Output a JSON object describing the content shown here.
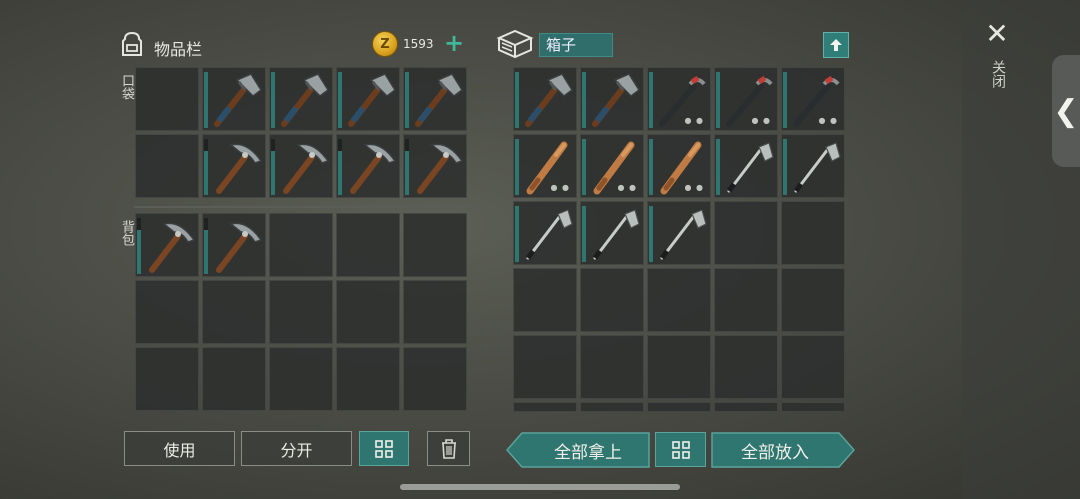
{
  "inventory": {
    "title": "物品栏",
    "coins": "1593",
    "coin_glyph": "Z",
    "plus_label": "+",
    "pocket_label": "口袋",
    "backpack_label": "背包",
    "pocket_rows": [
      [
        "",
        "axe",
        "axe",
        "axe",
        "axe"
      ],
      [
        "",
        "pickaxe",
        "pickaxe",
        "pickaxe",
        "pickaxe"
      ]
    ],
    "backpack_rows": [
      [
        "pickaxe",
        "pickaxe",
        "",
        "",
        ""
      ],
      [
        "",
        "",
        "",
        "",
        ""
      ],
      [
        "",
        "",
        "",
        "",
        ""
      ]
    ]
  },
  "box": {
    "title": "箱子",
    "rows": [
      [
        "axe",
        "axe",
        "crowbar",
        "crowbar",
        "crowbar"
      ],
      [
        "bat",
        "bat",
        "bat",
        "golf-club",
        "golf-club"
      ],
      [
        "golf-club",
        "golf-club",
        "golf-club",
        "",
        ""
      ],
      [
        "",
        "",
        "",
        "",
        ""
      ],
      [
        "",
        "",
        "",
        "",
        ""
      ]
    ]
  },
  "buttons": {
    "use": "使用",
    "split": "分开",
    "take_all": "全部拿上",
    "put_all": "全部放入"
  },
  "close": {
    "label": "关闭",
    "glyph": "✕"
  },
  "pull_tab_glyph": "❮",
  "colors": {
    "accent": "#2f7570",
    "coin": "#d8a21e"
  }
}
